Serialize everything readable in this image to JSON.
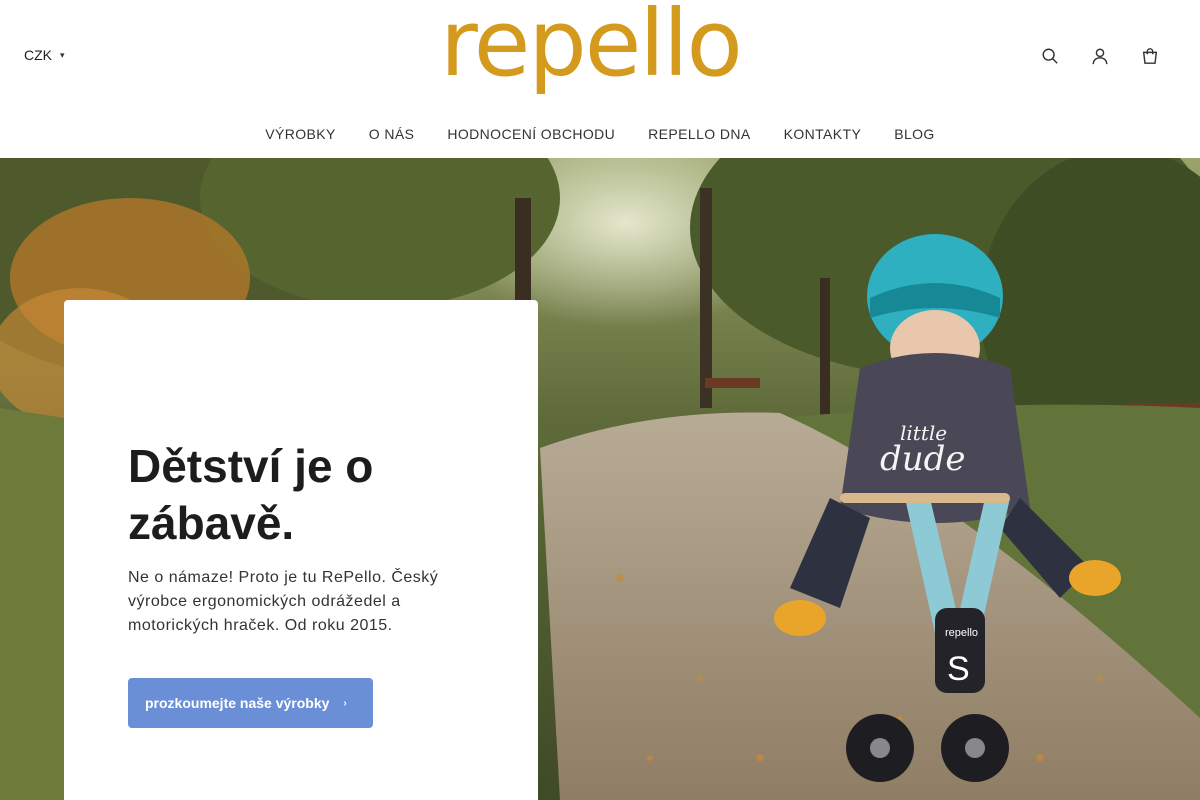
{
  "header": {
    "currency": "CZK",
    "logo_text": "repello",
    "icons": [
      "search-icon",
      "user-icon",
      "cart-icon"
    ]
  },
  "nav": {
    "items": [
      "VÝROBKY",
      "O NÁS",
      "HODNOCENÍ OBCHODU",
      "REPELLO DNA",
      "KONTAKTY",
      "BLOG"
    ]
  },
  "hero": {
    "title": "Dětství je o zábavě.",
    "text": "Ne o námaze! Proto je tu RePello. Český výrobce ergonomických odrážedel a motorických hraček. Od roku 2015.",
    "cta_label": "prozkoumejte naše výrobky",
    "shirt_text_1": "little",
    "shirt_text_2": "dude",
    "bike_badge": "repello",
    "bike_letter": "S"
  },
  "colors": {
    "brand": "#d49a1e",
    "cta": "#6b8fd6"
  }
}
